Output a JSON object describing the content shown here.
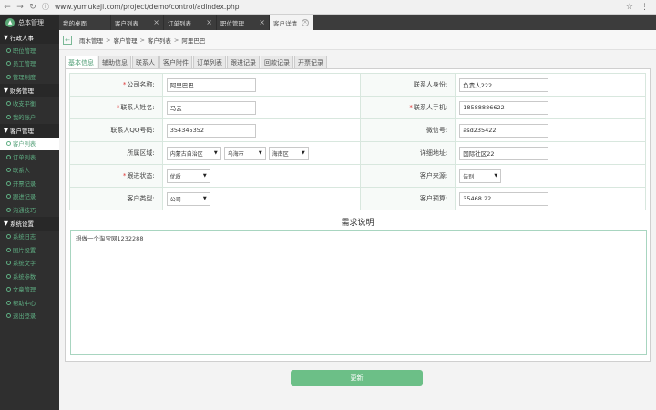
{
  "browser": {
    "url": "www.yumukeji.com/project/demo/control/adindex.php"
  },
  "logo": {
    "text": "总本管理"
  },
  "tabs": [
    {
      "label": "我的桌面",
      "closable": false
    },
    {
      "label": "客户列表",
      "closable": true
    },
    {
      "label": "订单列表",
      "closable": true
    },
    {
      "label": "职位管理",
      "closable": true
    },
    {
      "label": "客户详情",
      "closable": true,
      "active": true
    }
  ],
  "sidebar": {
    "groups": [
      {
        "title": "行政人事",
        "items": [
          "职位管理",
          "员工管理",
          "管理制度"
        ]
      },
      {
        "title": "财务管理",
        "items": [
          "收支平衡",
          "我的账户"
        ]
      },
      {
        "title": "客户管理",
        "items": [
          "客户列表",
          "订单列表",
          "联系人",
          "开票记录",
          "跟进记录",
          "沟通技巧"
        ]
      },
      {
        "title": "系统设置",
        "items": [
          "系统日志",
          "图片设置",
          "系统文字",
          "系统参数",
          "文章管理",
          "帮助中心",
          "退出登录"
        ]
      }
    ],
    "active_item": "客户列表"
  },
  "breadcrumb": [
    "雨木管理",
    "客户管理",
    "客户列表",
    "阿里巴巴"
  ],
  "subtabs": [
    "基本信息",
    "辅助信息",
    "联系人",
    "客户附件",
    "订单列表",
    "跟进记录",
    "回款记录",
    "开票记录"
  ],
  "form": {
    "company_label": "公司名称:",
    "company_value": "阿里巴巴",
    "identity_label": "联系人身份:",
    "identity_value": "负责人222",
    "contact_label": "联系人姓名:",
    "contact_value": "马云",
    "mobile_label": "联系人手机:",
    "mobile_value": "18588886622",
    "qq_label": "联系人QQ号码:",
    "qq_value": "354345352",
    "wechat_label": "微信号:",
    "wechat_value": "asd235422",
    "region_label": "所属区域:",
    "region_province": "内蒙古自治区",
    "region_city": "乌海市",
    "region_district": "海南区",
    "address_label": "详细地址:",
    "address_value": "国际社区22",
    "follow_label": "跟进状态:",
    "follow_value": "优质",
    "source_label": "客户来源:",
    "source_value": "告别",
    "type_label": "客户类型:",
    "type_value": "公司",
    "budget_label": "客户预算:",
    "budget_value": "35468.22"
  },
  "requirement": {
    "title": "需求说明",
    "text": "想做一个淘宝网1232288"
  },
  "update_button": "更新"
}
